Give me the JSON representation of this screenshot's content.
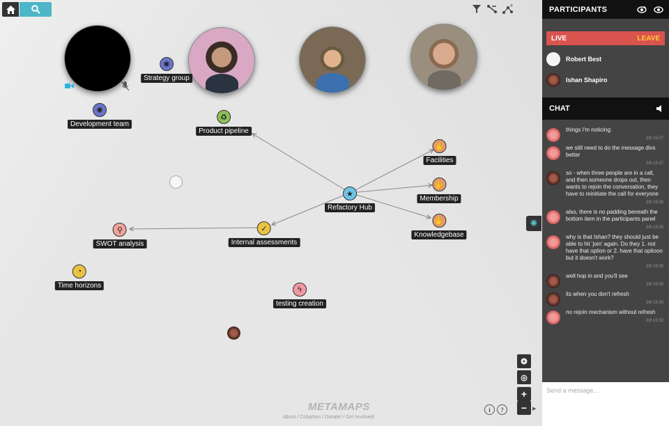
{
  "toolbar": {
    "home_icon": "home-icon",
    "search_icon": "search-icon"
  },
  "top_tools": [
    "filter-icon",
    "synapse-icon",
    "map-icon"
  ],
  "brand": "METAMAPS",
  "footer": "About / Colophon / Donate! / Get Involved!",
  "help": {
    "info": "i",
    "question": "?"
  },
  "zoom": {
    "zoom_in": "+",
    "zoom_out": "−"
  },
  "colors": {
    "accent": "#4db6c8",
    "live": "#d9534f",
    "leave": "#ffcc33",
    "panel_bg": "#444444"
  },
  "topics": [
    {
      "label": "Strategy group",
      "icon_color": "#6b75c9"
    },
    {
      "label": "Development team",
      "icon_color": "#6b75c9"
    },
    {
      "label": "Product pipeline",
      "icon_color": "#8fbf5a"
    },
    {
      "label": "Facilities",
      "icon_color": "#e39b6b"
    },
    {
      "label": "Membership",
      "icon_color": "#e39b6b"
    },
    {
      "label": "Knowledgebase",
      "icon_color": "#e39b6b"
    },
    {
      "label": "Refactory Hub",
      "icon_color": "#6fc3e6"
    },
    {
      "label": "Internal assessments",
      "icon_color": "#e9c341"
    },
    {
      "label": "SWOT analysis",
      "icon_color": "#f0a49a"
    },
    {
      "label": "Time horizons",
      "icon_color": "#e9c341"
    },
    {
      "label": "testing creation",
      "icon_color": "#f09aa2"
    }
  ],
  "participants_panel": {
    "title": "PARTICIPANTS",
    "live": "LIVE",
    "leave": "LEAVE",
    "participants": [
      {
        "name": "Robert Best"
      },
      {
        "name": "Ishan Shapiro"
      }
    ]
  },
  "chat": {
    "title": "CHAT",
    "placeholder": "Send a message...",
    "messages": [
      {
        "text": "things I'm noticing:",
        "time": "2/8 15:27"
      },
      {
        "text": "we still need to do the message divs better",
        "time": "2/8 15:27"
      },
      {
        "text": "so - when three people are in a call, and then someone drops out, then wants to rejoin the conversation, they have to reinitiate the call for everyone",
        "time": "2/8 15:28"
      },
      {
        "text": "also, there is no padding beneath the bottom item in the participants panel",
        "time": "2/8 15:29"
      },
      {
        "text": "why is that Ishan? they should just be able to hit 'join' again. Do they 1. not have that option or 2. have that optioon but it doesn't work?",
        "time": "2/8 15:29"
      },
      {
        "text": "well hop in and you'll see",
        "time": "2/8 15:29"
      },
      {
        "text": "its when you don't refresh",
        "time": "2/8 15:30"
      },
      {
        "text": "no rejoin mechanism without refresh",
        "time": "2/8 15:32"
      }
    ]
  }
}
